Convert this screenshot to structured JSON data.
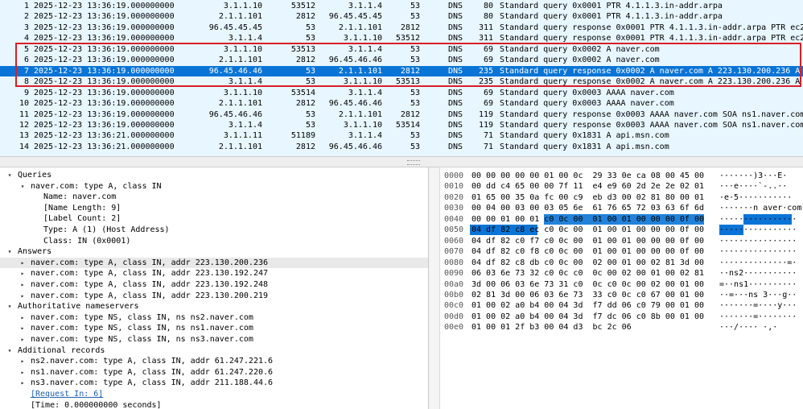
{
  "packets": [
    {
      "no": "1",
      "time": "2025-12-23 13:36:19.000000000",
      "src": "3.1.1.10",
      "sport": "53512",
      "dst": "3.1.1.4",
      "dport": "53",
      "proto": "DNS",
      "len": "80",
      "info": "Standard query 0x0001 PTR 4.1.1.3.in-addr.arpa"
    },
    {
      "no": "2",
      "time": "2025-12-23 13:36:19.000000000",
      "src": "2.1.1.101",
      "sport": "2812",
      "dst": "96.45.45.45",
      "dport": "53",
      "proto": "DNS",
      "len": "80",
      "info": "Standard query 0x0001 PTR 4.1.1.3.in-addr.arpa"
    },
    {
      "no": "3",
      "time": "2025-12-23 13:36:19.000000000",
      "src": "96.45.45.45",
      "sport": "53",
      "dst": "2.1.1.101",
      "dport": "2812",
      "proto": "DNS",
      "len": "311",
      "info": "Standard query response 0x0001 PTR 4.1.1.3.in-addr.arpa PTR ec2"
    },
    {
      "no": "4",
      "time": "2025-12-23 13:36:19.000000000",
      "src": "3.1.1.4",
      "sport": "53",
      "dst": "3.1.1.10",
      "dport": "53512",
      "proto": "DNS",
      "len": "311",
      "info": "Standard query response 0x0001 PTR 4.1.1.3.in-addr.arpa PTR ec2"
    },
    {
      "no": "5",
      "time": "2025-12-23 13:36:19.000000000",
      "src": "3.1.1.10",
      "sport": "53513",
      "dst": "3.1.1.4",
      "dport": "53",
      "proto": "DNS",
      "len": "69",
      "info": "Standard query 0x0002 A naver.com"
    },
    {
      "no": "6",
      "time": "2025-12-23 13:36:19.000000000",
      "src": "2.1.1.101",
      "sport": "2812",
      "dst": "96.45.46.46",
      "dport": "53",
      "proto": "DNS",
      "len": "69",
      "info": "Standard query 0x0002 A naver.com"
    },
    {
      "no": "7",
      "time": "2025-12-23 13:36:19.000000000",
      "src": "96.45.46.46",
      "sport": "53",
      "dst": "2.1.1.101",
      "dport": "2812",
      "proto": "DNS",
      "len": "235",
      "info": "Standard query response 0x0002 A naver.com A 223.130.200.236 A"
    },
    {
      "no": "8",
      "time": "2025-12-23 13:36:19.000000000",
      "src": "3.1.1.4",
      "sport": "53",
      "dst": "3.1.1.10",
      "dport": "53513",
      "proto": "DNS",
      "len": "235",
      "info": "Standard query response 0x0002 A naver.com A 223.130.200.236 A"
    },
    {
      "no": "9",
      "time": "2025-12-23 13:36:19.000000000",
      "src": "3.1.1.10",
      "sport": "53514",
      "dst": "3.1.1.4",
      "dport": "53",
      "proto": "DNS",
      "len": "69",
      "info": "Standard query 0x0003 AAAA naver.com"
    },
    {
      "no": "10",
      "time": "2025-12-23 13:36:19.000000000",
      "src": "2.1.1.101",
      "sport": "2812",
      "dst": "96.45.46.46",
      "dport": "53",
      "proto": "DNS",
      "len": "69",
      "info": "Standard query 0x0003 AAAA naver.com"
    },
    {
      "no": "11",
      "time": "2025-12-23 13:36:19.000000000",
      "src": "96.45.46.46",
      "sport": "53",
      "dst": "2.1.1.101",
      "dport": "2812",
      "proto": "DNS",
      "len": "119",
      "info": "Standard query response 0x0003 AAAA naver.com SOA ns1.naver.com"
    },
    {
      "no": "12",
      "time": "2025-12-23 13:36:19.000000000",
      "src": "3.1.1.4",
      "sport": "53",
      "dst": "3.1.1.10",
      "dport": "53514",
      "proto": "DNS",
      "len": "119",
      "info": "Standard query response 0x0003 AAAA naver.com SOA ns1.naver.com"
    },
    {
      "no": "13",
      "time": "2025-12-23 13:36:21.000000000",
      "src": "3.1.1.11",
      "sport": "51189",
      "dst": "3.1.1.4",
      "dport": "53",
      "proto": "DNS",
      "len": "71",
      "info": "Standard query 0x1831 A api.msn.com"
    },
    {
      "no": "14",
      "time": "2025-12-23 13:36:21.000000000",
      "src": "2.1.1.101",
      "sport": "2812",
      "dst": "96.45.46.46",
      "dport": "53",
      "proto": "DNS",
      "len": "71",
      "info": "Standard query 0x1831 A api.msn.com"
    }
  ],
  "details": [
    {
      "indent": 0,
      "toggle": "▾",
      "text": "Queries"
    },
    {
      "indent": 1,
      "toggle": "▾",
      "text": "naver.com: type A, class IN"
    },
    {
      "indent": 2,
      "toggle": "",
      "text": "Name: naver.com"
    },
    {
      "indent": 2,
      "toggle": "",
      "text": "[Name Length: 9]"
    },
    {
      "indent": 2,
      "toggle": "",
      "text": "[Label Count: 2]"
    },
    {
      "indent": 2,
      "toggle": "",
      "text": "Type: A (1) (Host Address)"
    },
    {
      "indent": 2,
      "toggle": "",
      "text": "Class: IN (0x0001)"
    },
    {
      "indent": 0,
      "toggle": "▾",
      "text": "Answers"
    },
    {
      "indent": 1,
      "toggle": "▸",
      "text": "naver.com: type A, class IN, addr 223.130.200.236"
    },
    {
      "indent": 1,
      "toggle": "▸",
      "text": "naver.com: type A, class IN, addr 223.130.192.247"
    },
    {
      "indent": 1,
      "toggle": "▸",
      "text": "naver.com: type A, class IN, addr 223.130.192.248"
    },
    {
      "indent": 1,
      "toggle": "▸",
      "text": "naver.com: type A, class IN, addr 223.130.200.219"
    },
    {
      "indent": 0,
      "toggle": "▾",
      "text": "Authoritative nameservers"
    },
    {
      "indent": 1,
      "toggle": "▸",
      "text": "naver.com: type NS, class IN, ns ns2.naver.com"
    },
    {
      "indent": 1,
      "toggle": "▸",
      "text": "naver.com: type NS, class IN, ns ns1.naver.com"
    },
    {
      "indent": 1,
      "toggle": "▸",
      "text": "naver.com: type NS, class IN, ns ns3.naver.com"
    },
    {
      "indent": 0,
      "toggle": "▾",
      "text": "Additional records"
    },
    {
      "indent": 1,
      "toggle": "▸",
      "text": "ns2.naver.com: type A, class IN, addr 61.247.221.6"
    },
    {
      "indent": 1,
      "toggle": "▸",
      "text": "ns1.naver.com: type A, class IN, addr 61.247.220.6"
    },
    {
      "indent": 1,
      "toggle": "▸",
      "text": "ns3.naver.com: type A, class IN, addr 211.188.44.6"
    },
    {
      "indent": 1,
      "toggle": "",
      "text": "[Request In: 6]",
      "link": true
    },
    {
      "indent": 1,
      "toggle": "",
      "text": "[Time: 0.000000000 seconds]"
    }
  ],
  "hex": [
    {
      "off": "0000",
      "bytes": "00 00 00 00 00 01 00 0c  29 33 0e ca 08 00 45 00",
      "ascii": "·······)3···E·"
    },
    {
      "off": "0010",
      "bytes": "00 dd c4 65 00 00 7f 11  e4 e9 60 2d 2e 2e 02 01",
      "ascii": "···e····`-..··"
    },
    {
      "off": "0020",
      "bytes": "01 65 00 35 0a fc 00 c9  eb d3 00 02 81 80 00 01",
      "ascii": "·e·5···········"
    },
    {
      "off": "0030",
      "bytes": "00 04 00 03 00 03 05 6e  61 76 65 72 03 63 6f 6d",
      "ascii": "·······n aver·com"
    },
    {
      "off": "0040",
      "bytes": "00 00 01 00 01 c0 0c 00  01 00 01 00 00 00 0f 00",
      "ascii": "················",
      "hl_from": 15,
      "hl_ascii_from": 5
    },
    {
      "off": "0050",
      "bytes": "04 df 82 c8 ec c0 0c 00  01 00 01 00 00 00 0f 00",
      "ascii": "················",
      "hl_to": 14,
      "hl_ascii_to": 5
    },
    {
      "off": "0060",
      "bytes": "04 df 82 c0 f7 c0 0c 00  01 00 01 00 00 00 0f 00",
      "ascii": "················"
    },
    {
      "off": "0070",
      "bytes": "04 df 82 c0 f8 c0 0c 00  01 00 01 00 00 00 0f 00",
      "ascii": "················"
    },
    {
      "off": "0080",
      "bytes": "04 df 82 c8 db c0 0c 00  02 00 01 00 02 81 3d 00",
      "ascii": "··············=·"
    },
    {
      "off": "0090",
      "bytes": "06 03 6e 73 32 c0 0c c0  0c 00 02 00 01 00 02 81",
      "ascii": "··ns2···········"
    },
    {
      "off": "00a0",
      "bytes": "3d 00 06 03 6e 73 31 c0  0c c0 0c 00 02 00 01 00",
      "ascii": "=··ns1··········"
    },
    {
      "off": "00b0",
      "bytes": "02 81 3d 00 06 03 6e 73  33 c0 0c c0 67 00 01 00",
      "ascii": "··=···ns 3···g··"
    },
    {
      "off": "00c0",
      "bytes": "01 00 02 a0 b4 00 04 3d  f7 dd 06 c0 79 00 01 00",
      "ascii": "·······=····y···"
    },
    {
      "off": "00d0",
      "bytes": "01 00 02 a0 b4 00 04 3d  f7 dc 06 c0 8b 00 01 00",
      "ascii": "·······=········"
    },
    {
      "off": "00e0",
      "bytes": "01 00 01 2f b3 00 04 d3  bc 2c 06",
      "ascii": "···/···· ·,·"
    }
  ],
  "selected_packet_index": 6
}
